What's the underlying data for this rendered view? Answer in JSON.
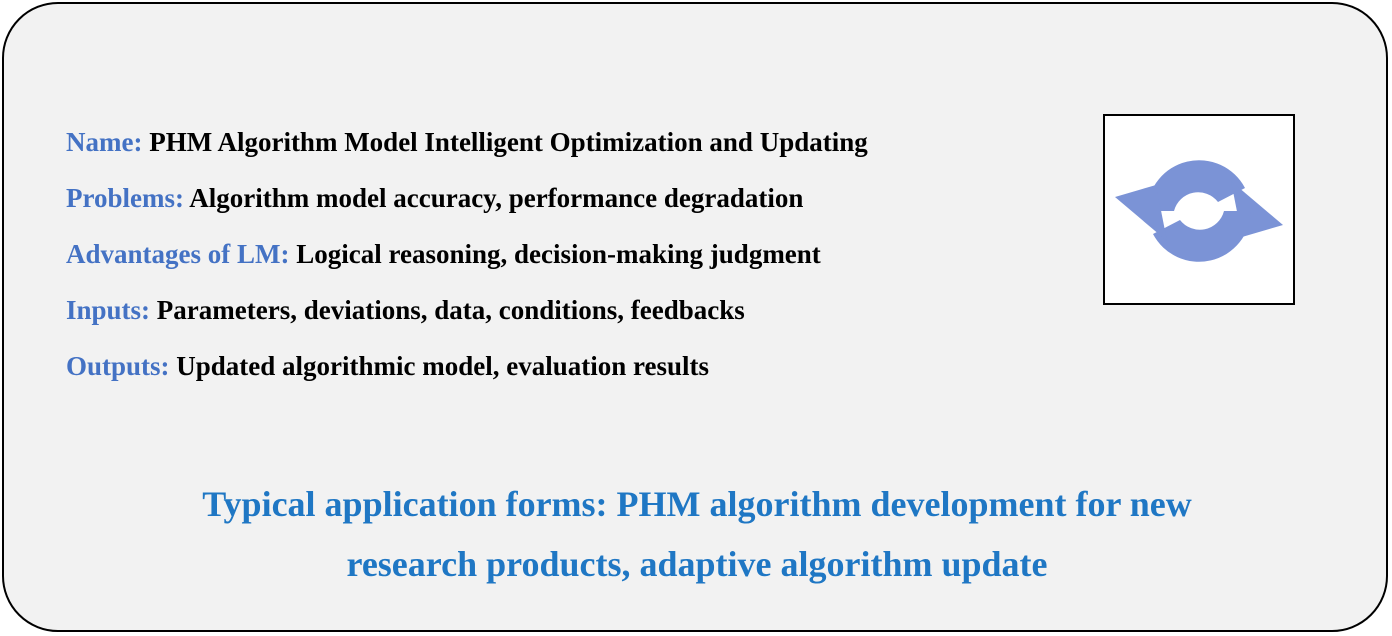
{
  "rows": [
    {
      "label": "Name:",
      "value": "PHM Algorithm Model Intelligent Optimization and Updating"
    },
    {
      "label": "Problems:",
      "value": "Algorithm model accuracy, performance degradation"
    },
    {
      "label": "Advantages of LM:",
      "value": "Logical reasoning, decision-making judgment"
    },
    {
      "label": "Inputs:",
      "value": "Parameters, deviations, data, conditions, feedbacks"
    },
    {
      "label": "Outputs:",
      "value": "Updated algorithmic model, evaluation results"
    }
  ],
  "footer": {
    "line1": "Typical application forms: PHM algorithm development for new",
    "line2": "research products, adaptive algorithm update"
  },
  "icon": {
    "name": "refresh-icon",
    "color": "#7b93d6"
  },
  "colors": {
    "label": "#4472c4",
    "value": "#000000",
    "footer": "#1f77c4",
    "card_background": "#f2f2f2"
  }
}
